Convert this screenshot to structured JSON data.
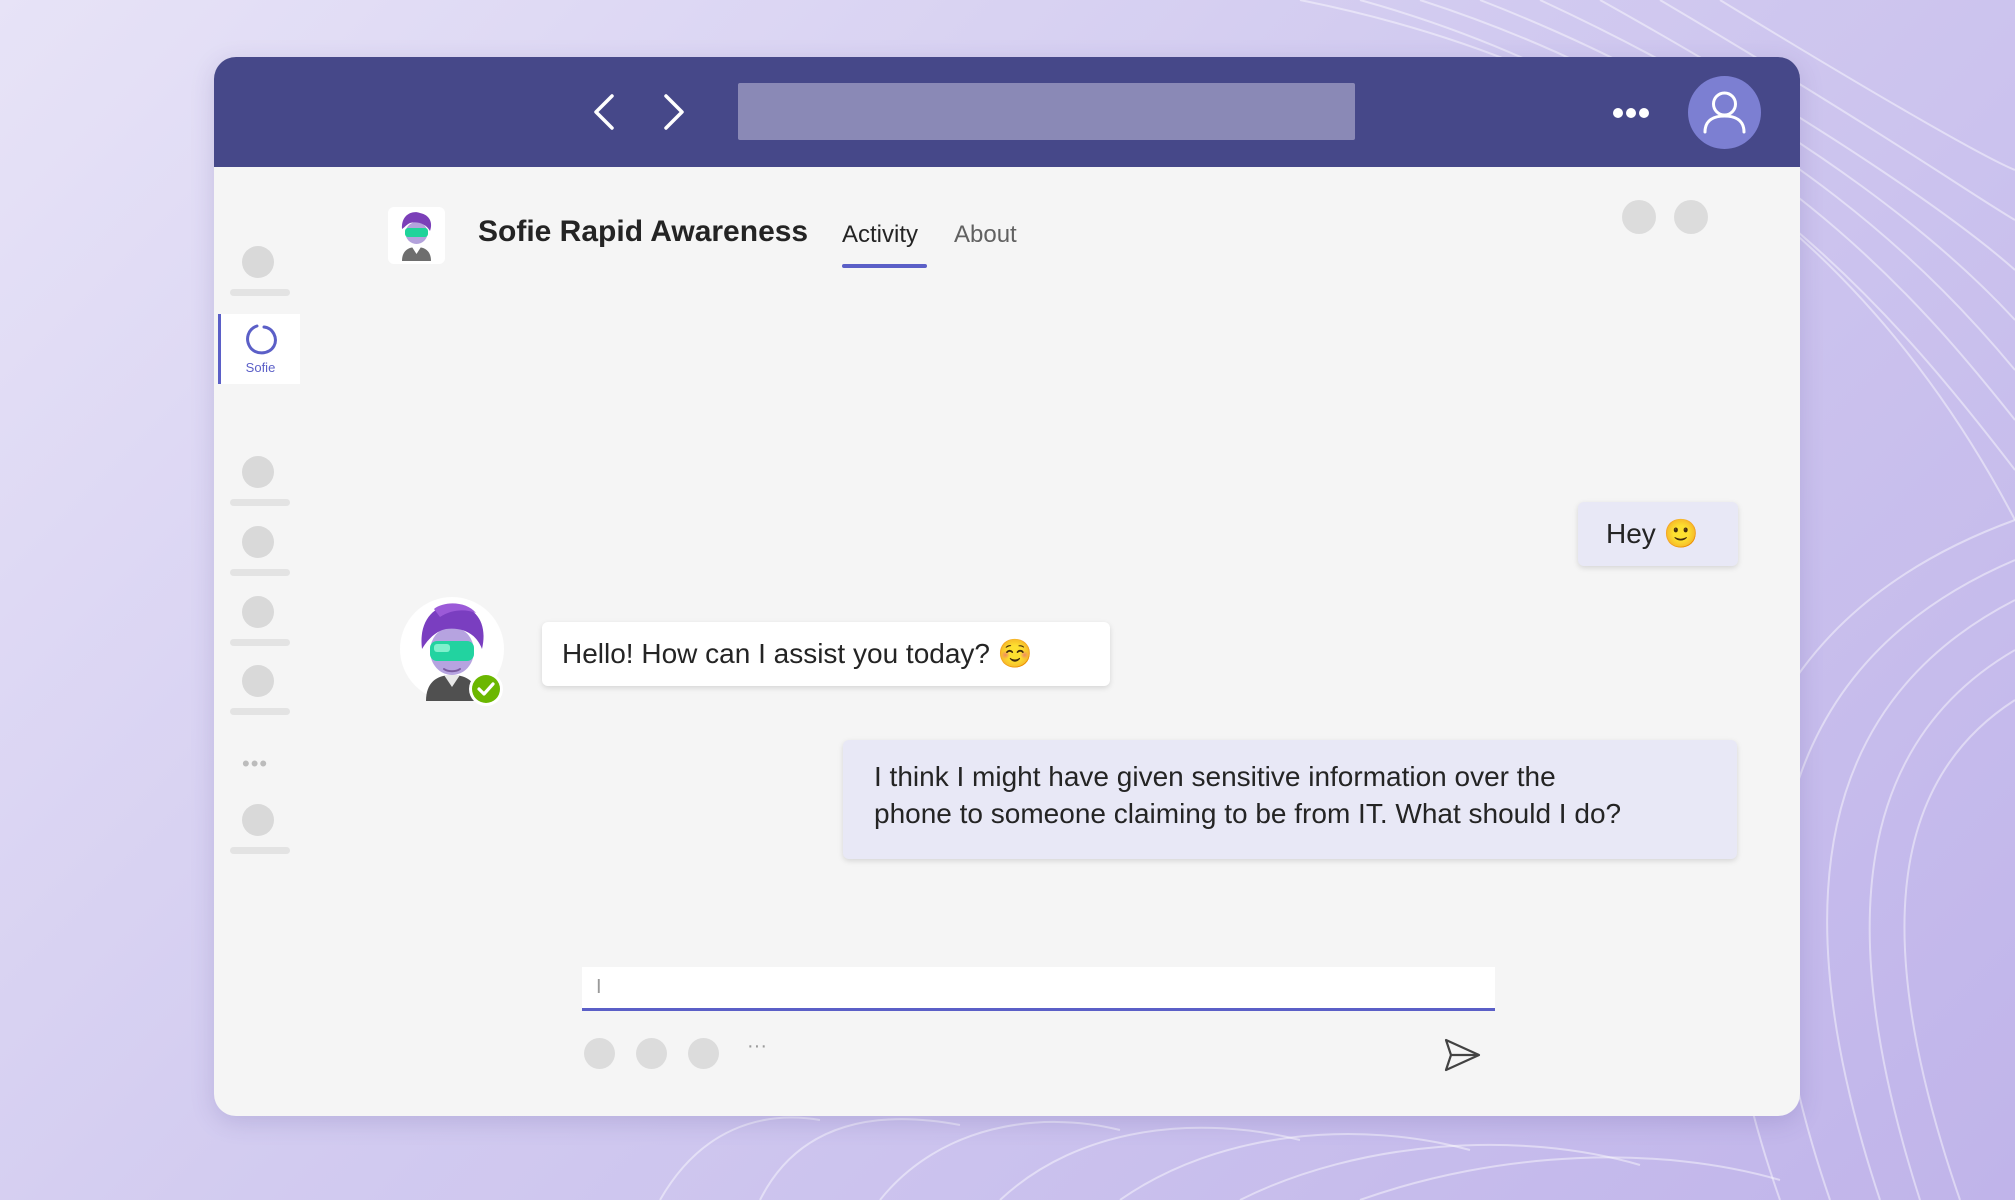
{
  "app": {
    "name": "Sofie Rapid Awareness",
    "tabs": [
      {
        "label": "Activity",
        "active": true
      },
      {
        "label": "About",
        "active": false
      }
    ]
  },
  "rail": {
    "active_label": "Sofie"
  },
  "messages": [
    {
      "sender": "user",
      "text": "Hey 🙂"
    },
    {
      "sender": "bot",
      "text": "Hello! How can I assist you today? ☺️"
    },
    {
      "sender": "user",
      "line1": "I think I might have given sensitive information over the",
      "line2": "phone to someone claiming to be from IT. What should I do?"
    }
  ],
  "composer": {
    "value": "I",
    "ellipsis": "···"
  },
  "icons": {
    "back": "chevron-left-icon",
    "forward": "chevron-right-icon",
    "more": "more-horizontal-icon",
    "profile": "person-icon",
    "send": "send-icon",
    "status": "checkmark-badge-icon"
  },
  "colors": {
    "topbar": "#464889",
    "accent": "#5b5fc7",
    "status_green": "#6bb700"
  }
}
